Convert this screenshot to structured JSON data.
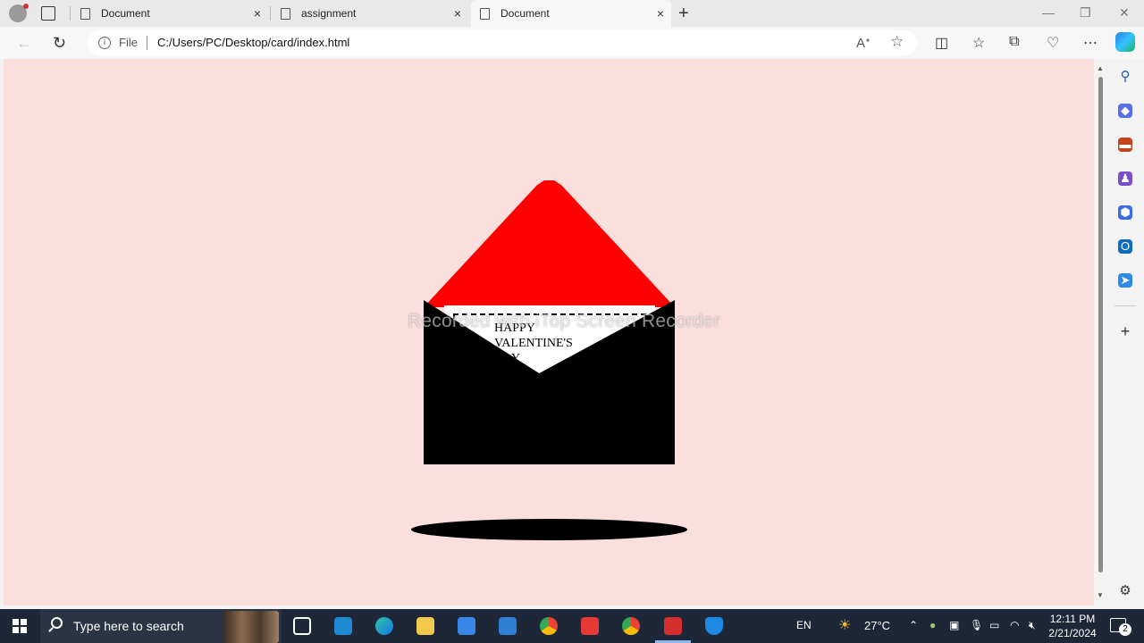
{
  "tabs": [
    {
      "title": "Document",
      "close": "×"
    },
    {
      "title": "assignment",
      "close": "×"
    },
    {
      "title": "Document",
      "close": "×"
    }
  ],
  "window_controls": {
    "minimize": "—",
    "restore": "❐",
    "close": "✕"
  },
  "address": {
    "scheme_label": "File",
    "url": "C:/Users/PC/Desktop/card/index.html"
  },
  "page": {
    "letter_text": "HAPPY VALENTINE'S DAY",
    "watermark": "Recorded with iTop Screen Recorder",
    "background": "#fbdfdd",
    "flap_color": "#ff0000",
    "envelope_color": "#000000"
  },
  "taskbar": {
    "search_placeholder": "Type here to search",
    "language": "EN",
    "weather": "27°C",
    "time": "12:11 PM",
    "date": "2/21/2024",
    "notification_count": "2"
  }
}
